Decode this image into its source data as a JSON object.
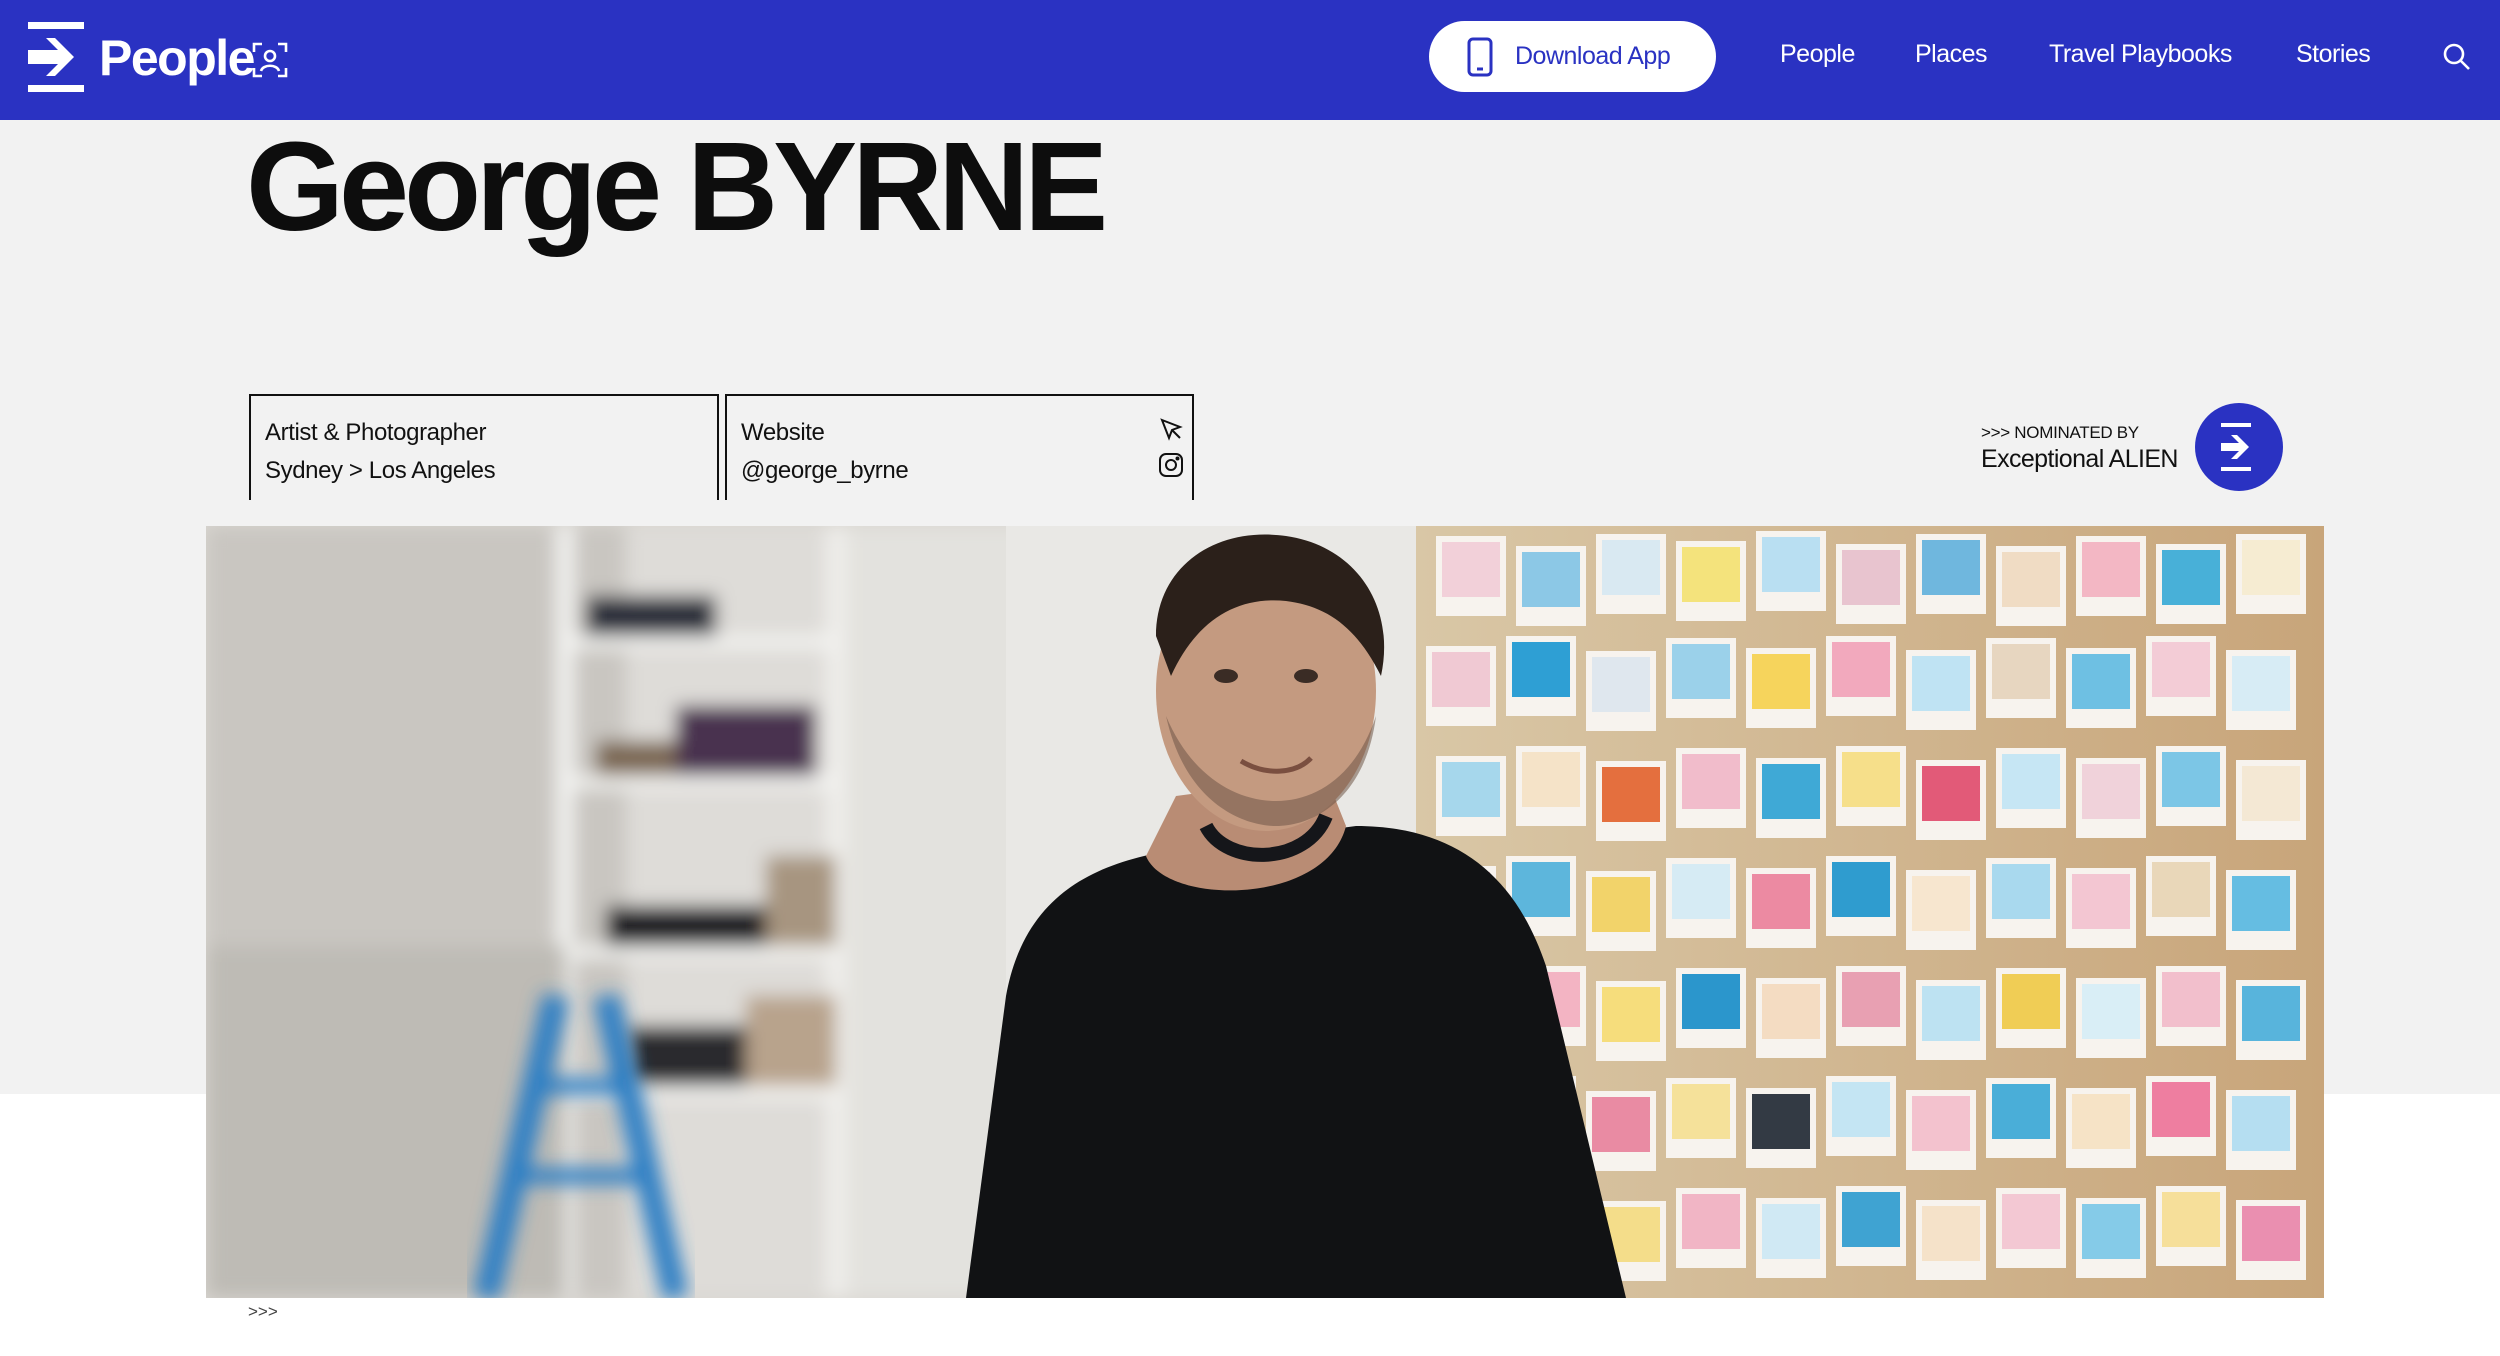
{
  "nav": {
    "brand": "People",
    "download_label": "Download App",
    "links": [
      "People",
      "Places",
      "Travel Playbooks",
      "Stories"
    ],
    "icons": [
      "arrow-logo-icon",
      "scan-face-icon",
      "phone-icon",
      "search-icon"
    ],
    "background": "#2a32c2"
  },
  "profile": {
    "name": "George BYRNE",
    "role": "Artist & Photographer",
    "location": "Sydney > Los Angeles",
    "website_label": "Website",
    "instagram": "@george_byrne"
  },
  "nomination": {
    "prefix": ">>> NOMINATED BY",
    "nominator": "Exceptional ALIEN"
  },
  "photo": {
    "caption": ">>>"
  }
}
